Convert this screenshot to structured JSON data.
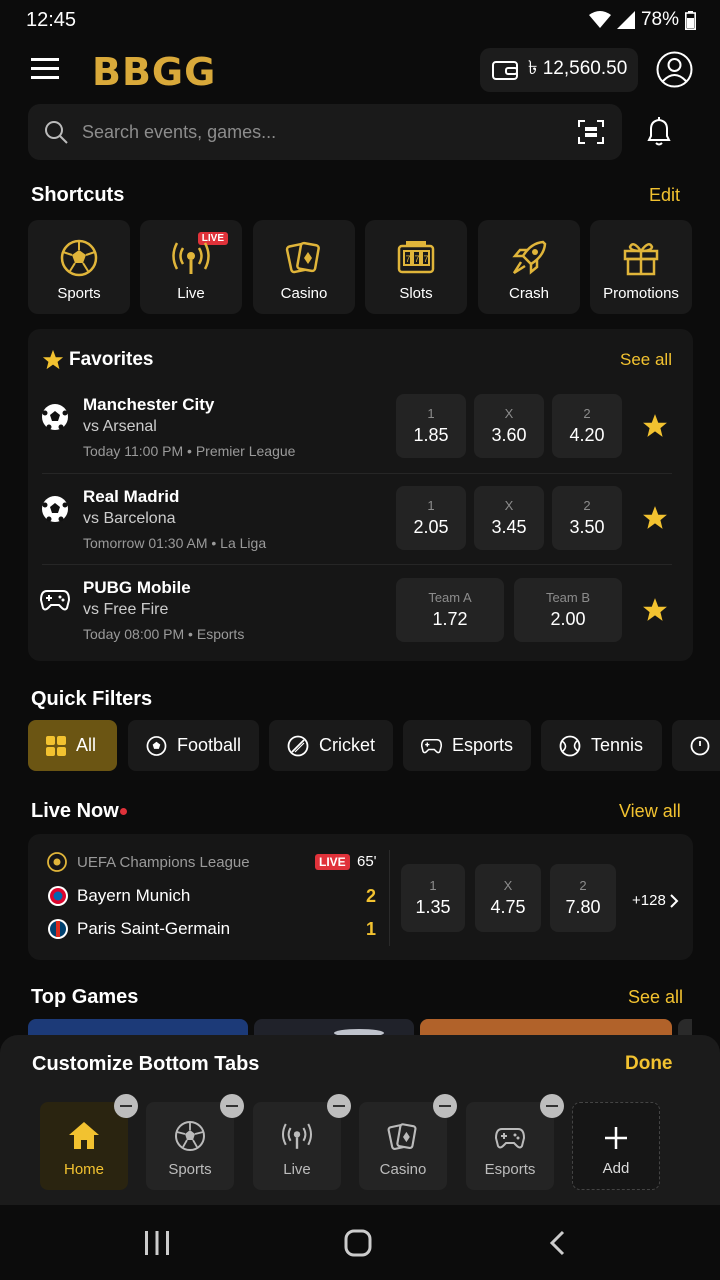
{
  "status": {
    "time": "12:45",
    "battery": "78%"
  },
  "header": {
    "logo": "BBGG",
    "balance": "৳ 12,560.50"
  },
  "search": {
    "placeholder": "Search events, games..."
  },
  "shortcuts": {
    "title": "Shortcuts",
    "edit": "Edit",
    "live_badge": "LIVE",
    "items": [
      {
        "label": "Sports",
        "icon": "soccer-ball-icon"
      },
      {
        "label": "Live",
        "icon": "broadcast-icon"
      },
      {
        "label": "Casino",
        "icon": "cards-icon"
      },
      {
        "label": "Slots",
        "icon": "slot-machine-icon"
      },
      {
        "label": "Crash",
        "icon": "rocket-icon"
      },
      {
        "label": "Promotions",
        "icon": "gift-icon"
      }
    ]
  },
  "favorites": {
    "title": "Favorites",
    "see_all": "See all",
    "matches": [
      {
        "team": "Manchester City",
        "opponent": "vs Arsenal",
        "meta": "Today 11:00 PM • Premier League",
        "odds": [
          {
            "label": "1",
            "value": "1.85"
          },
          {
            "label": "X",
            "value": "3.60"
          },
          {
            "label": "2",
            "value": "4.20"
          }
        ]
      },
      {
        "team": "Real Madrid",
        "opponent": "vs Barcelona",
        "meta": "Tomorrow 01:30 AM • La Liga",
        "odds": [
          {
            "label": "1",
            "value": "2.05"
          },
          {
            "label": "X",
            "value": "3.45"
          },
          {
            "label": "2",
            "value": "3.50"
          }
        ]
      },
      {
        "team": "PUBG Mobile",
        "opponent": "vs Free Fire",
        "meta": "Today 08:00 PM • Esports",
        "odds": [
          {
            "label": "Team A",
            "value": "1.72"
          },
          {
            "label": "Team B",
            "value": "2.00"
          }
        ]
      }
    ]
  },
  "quick_filters": {
    "title": "Quick Filters",
    "items": [
      "All",
      "Football",
      "Cricket",
      "Esports",
      "Tennis"
    ]
  },
  "live_now": {
    "title": "Live Now",
    "view_all": "View all",
    "league": "UEFA Champions League",
    "live": "LIVE",
    "minute": "65'",
    "home": {
      "name": "Bayern Munich",
      "score": "2"
    },
    "away": {
      "name": "Paris Saint-Germain",
      "score": "1"
    },
    "odds": [
      {
        "label": "1",
        "value": "1.35"
      },
      {
        "label": "X",
        "value": "4.75"
      },
      {
        "label": "2",
        "value": "7.80"
      }
    ],
    "more": "+128"
  },
  "top_games": {
    "title": "Top Games",
    "see_all": "See all"
  },
  "customize": {
    "title": "Customize Bottom Tabs",
    "done": "Done",
    "tabs": [
      {
        "label": "Home",
        "icon": "home-icon"
      },
      {
        "label": "Sports",
        "icon": "soccer-ball-icon"
      },
      {
        "label": "Live",
        "icon": "broadcast-icon"
      },
      {
        "label": "Casino",
        "icon": "cards-icon"
      },
      {
        "label": "Esports",
        "icon": "gamepad-icon"
      },
      {
        "label": "Add",
        "icon": "plus-icon"
      }
    ]
  },
  "colors": {
    "accent": "#f2c230",
    "background": "#0c0c0c",
    "card": "#161616",
    "live": "#e0323a"
  }
}
